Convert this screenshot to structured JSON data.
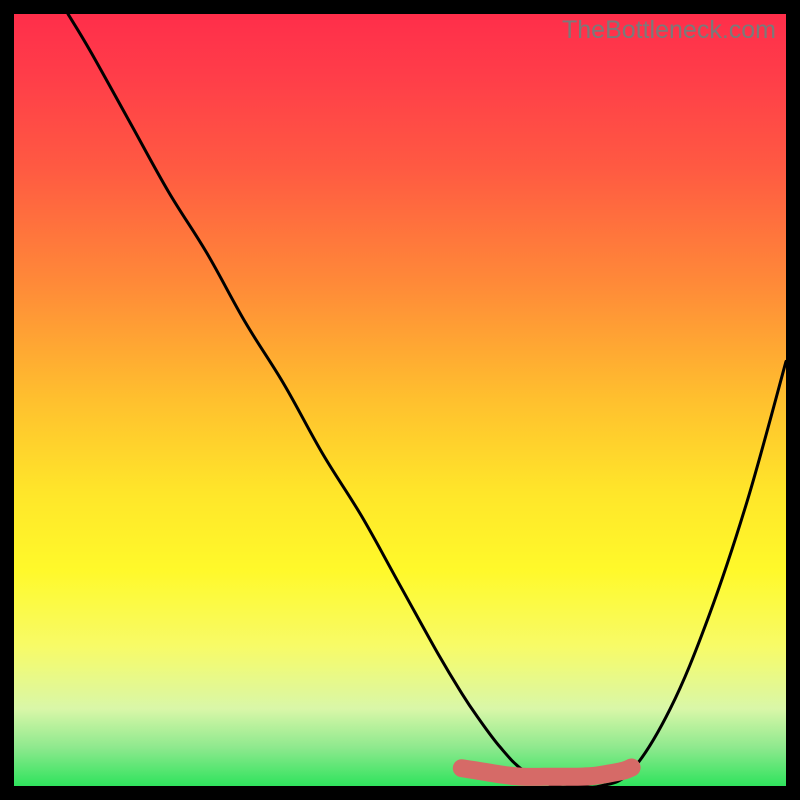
{
  "watermark": "TheBottleneck.com",
  "chart_data": {
    "type": "line",
    "title": "",
    "xlabel": "",
    "ylabel": "",
    "xlim": [
      0,
      100
    ],
    "ylim": [
      0,
      100
    ],
    "series": [
      {
        "name": "bottleneck-curve",
        "x": [
          7,
          10,
          15,
          20,
          25,
          30,
          35,
          40,
          45,
          50,
          55,
          58,
          60,
          63,
          66,
          70,
          73,
          76,
          80,
          85,
          90,
          95,
          100
        ],
        "y_pct": [
          100,
          95,
          86,
          77,
          69,
          60,
          52,
          43,
          35,
          26,
          17,
          12,
          9,
          5,
          2,
          0,
          0,
          0,
          2,
          10,
          22,
          37,
          55
        ]
      }
    ],
    "highlight_segment": {
      "name": "optimal-range",
      "color": "#d66a67",
      "x": [
        58,
        60,
        63,
        66,
        70,
        73,
        75,
        77,
        79,
        80
      ],
      "y_pct": [
        2.3,
        2.0,
        1.5,
        1.2,
        1.2,
        1.2,
        1.3,
        1.6,
        2.0,
        2.4
      ]
    },
    "gradient_stops": [
      {
        "pos": 0,
        "color": "#ff2e4a"
      },
      {
        "pos": 50,
        "color": "#ffc02e"
      },
      {
        "pos": 72,
        "color": "#fff92a"
      },
      {
        "pos": 100,
        "color": "#2fe35d"
      }
    ]
  }
}
